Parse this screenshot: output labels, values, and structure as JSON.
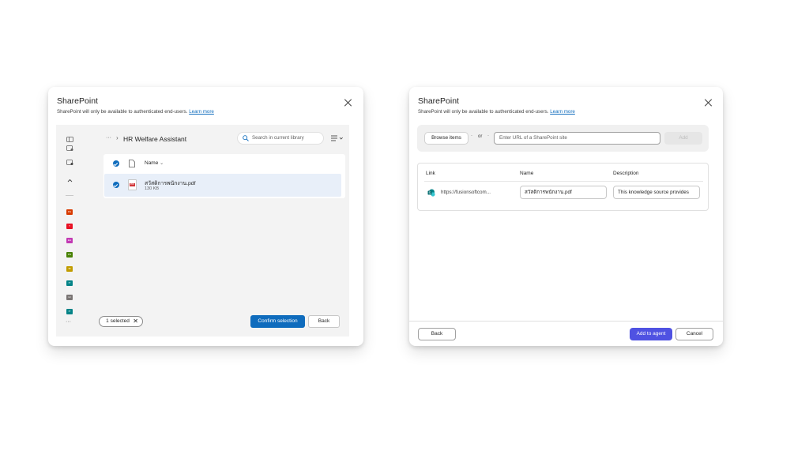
{
  "left_dialog": {
    "title": "SharePoint",
    "subtitle": "SharePoint will only be available to authenticated end-users.",
    "learn_more": "Learn more",
    "breadcrumb": {
      "ellipsis": "···",
      "separator": "›",
      "current": "HR Welfare Assistant"
    },
    "search": {
      "placeholder": "Search in current library"
    },
    "view_toggle_icon": "list-view-icon",
    "list": {
      "column_name": "Name",
      "files": [
        {
          "name": "สวัสดิการพนักงาน.pdf",
          "size": "130 KB",
          "type_badge": "PDF",
          "selected": true
        }
      ]
    },
    "rail_tiles": [
      {
        "label": "PH",
        "color": "#d83b01"
      },
      {
        "label": "T",
        "color": "#e81123"
      },
      {
        "label": "EH",
        "color": "#c239b3"
      },
      {
        "label": "DS",
        "color": "#498205"
      },
      {
        "label": "BI",
        "color": "#c19c00"
      },
      {
        "label": "IT",
        "color": "#038387"
      },
      {
        "label": "HI",
        "color": "#7a7574"
      },
      {
        "label": "IT",
        "color": "#038387"
      }
    ],
    "rail_more": "···",
    "selected_chip": "1 selected",
    "confirm_button": "Confirm selection",
    "back_button": "Back"
  },
  "right_dialog": {
    "title": "SharePoint",
    "subtitle": "SharePoint will only be available to authenticated end-users.",
    "learn_more": "Learn more",
    "browse_button": "Browse items",
    "or_label": "or",
    "url_input": {
      "placeholder": "Enter URL of a SharePoint site"
    },
    "add_button": "Add",
    "table": {
      "headers": [
        "Link",
        "Name",
        "Description"
      ],
      "rows": [
        {
          "link": "https://fusionsoftcom...",
          "name": "สวัสดิการพนักงาน.pdf",
          "description": "This knowledge source provides"
        }
      ]
    },
    "back_button": "Back",
    "add_to_agent_button": "Add to agent",
    "cancel_button": "Cancel"
  },
  "colors": {
    "primary": "#0f6cbd",
    "agent_primary": "#4f52e2",
    "selected_row": "#e8eff9",
    "sharepoint": "#036c70"
  }
}
